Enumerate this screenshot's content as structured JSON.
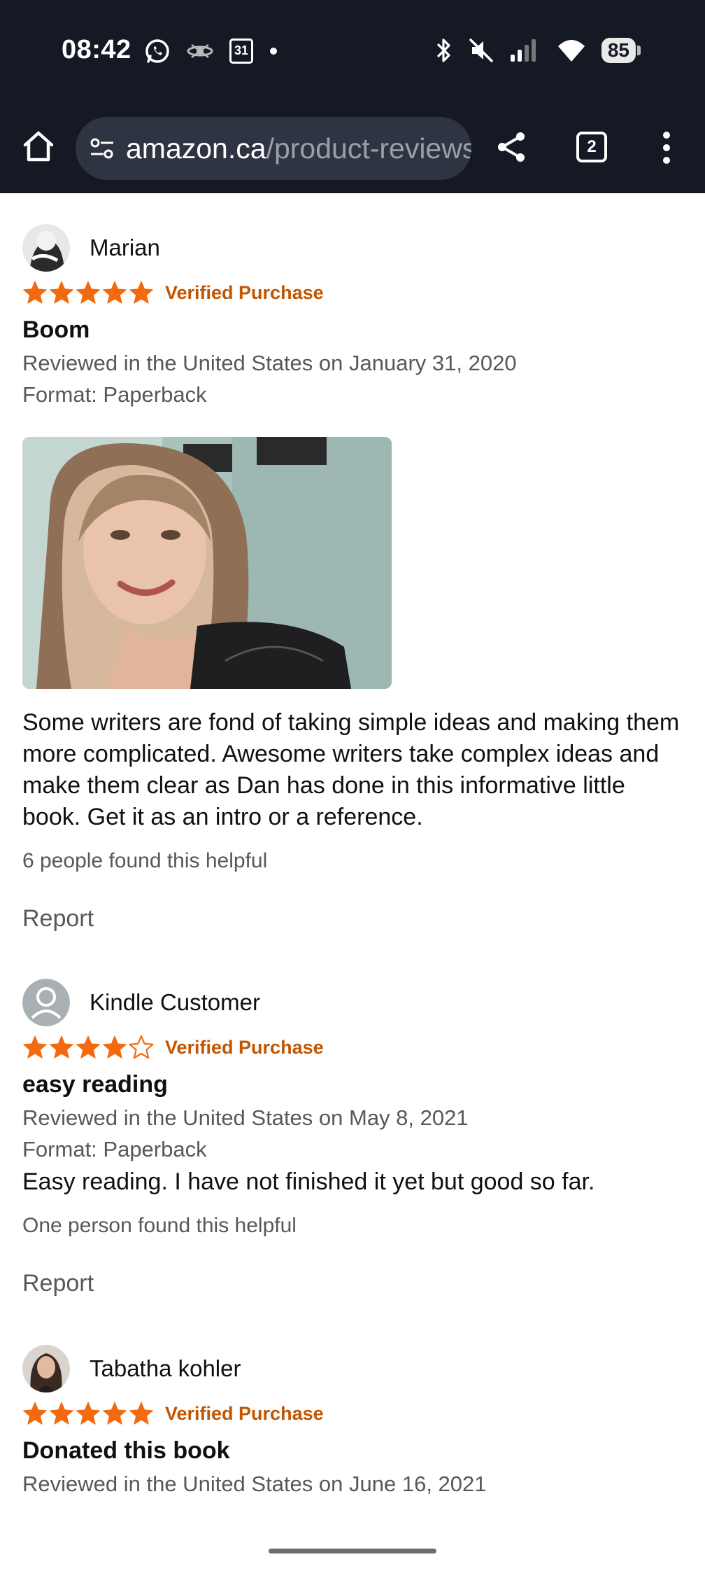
{
  "status_bar": {
    "time": "08:42",
    "left_icons": [
      "whatsapp-icon",
      "blinkist-icon",
      "calendar-icon",
      "dot-icon"
    ],
    "calendar_day": "31",
    "right_icons": [
      "bluetooth-icon",
      "mute-icon",
      "signal-icon",
      "wifi-icon"
    ],
    "battery": "85"
  },
  "browser": {
    "url_domain": "amazon.ca",
    "url_path": "/product-reviews",
    "tab_count": "2"
  },
  "colors": {
    "star": "#f3690f",
    "verified": "#c45500",
    "bar_bg": "#141923"
  },
  "reviews": [
    {
      "reviewer": "Marian",
      "rating": 5,
      "verified": "Verified Purchase",
      "title": "Boom",
      "date": "Reviewed in the United States on January 31, 2020",
      "format": "Format: Paperback",
      "has_photo": true,
      "body": "Some writers are fond of taking simple ideas and making them more complicated. Awesome writers take complex ideas and make them clear as Dan has done in this informative little book. Get it as an intro or a reference.",
      "helpful": "6 people found this helpful",
      "report": "Report"
    },
    {
      "reviewer": "Kindle Customer",
      "rating": 4,
      "verified": "Verified Purchase",
      "title": "easy reading",
      "date": "Reviewed in the United States on May 8, 2021",
      "format": "Format: Paperback",
      "body": "Easy reading. I have not finished it yet but good so far.",
      "helpful": "One person found this helpful",
      "report": "Report"
    },
    {
      "reviewer": "Tabatha kohler",
      "rating": 5,
      "verified": "Verified Purchase",
      "title": "Donated this book",
      "date": "Reviewed in the United States on June 16, 2021"
    }
  ]
}
